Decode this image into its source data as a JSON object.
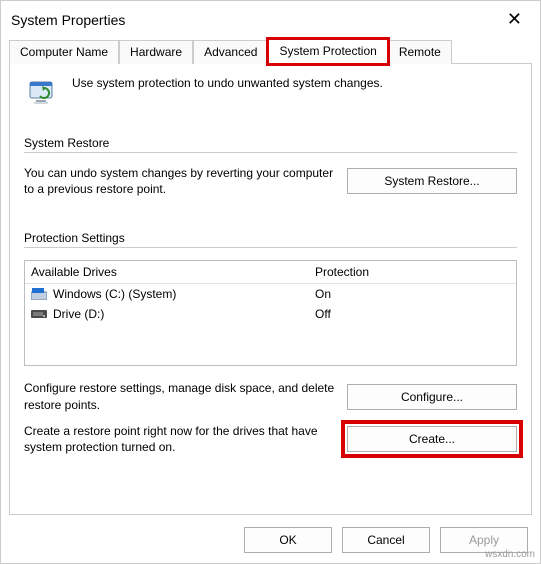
{
  "window": {
    "title": "System Properties"
  },
  "tabs": {
    "computer_name": "Computer Name",
    "hardware": "Hardware",
    "advanced": "Advanced",
    "system_protection": "System Protection",
    "remote": "Remote"
  },
  "intro_text": "Use system protection to undo unwanted system changes.",
  "restore_group": {
    "title": "System Restore",
    "text": "You can undo system changes by reverting your computer to a previous restore point.",
    "button": "System Restore..."
  },
  "protection_group": {
    "title": "Protection Settings",
    "header_drives": "Available Drives",
    "header_protection": "Protection",
    "drives": [
      {
        "name": "Windows (C:) (System)",
        "protection": "On",
        "type": "win"
      },
      {
        "name": "Drive (D:)",
        "protection": "Off",
        "type": "hdd"
      }
    ],
    "configure_text": "Configure restore settings, manage disk space, and delete restore points.",
    "configure_button": "Configure...",
    "create_text": "Create a restore point right now for the drives that have system protection turned on.",
    "create_button": "Create..."
  },
  "footer": {
    "ok": "OK",
    "cancel": "Cancel",
    "apply": "Apply"
  },
  "watermark": "wsxdn.com"
}
